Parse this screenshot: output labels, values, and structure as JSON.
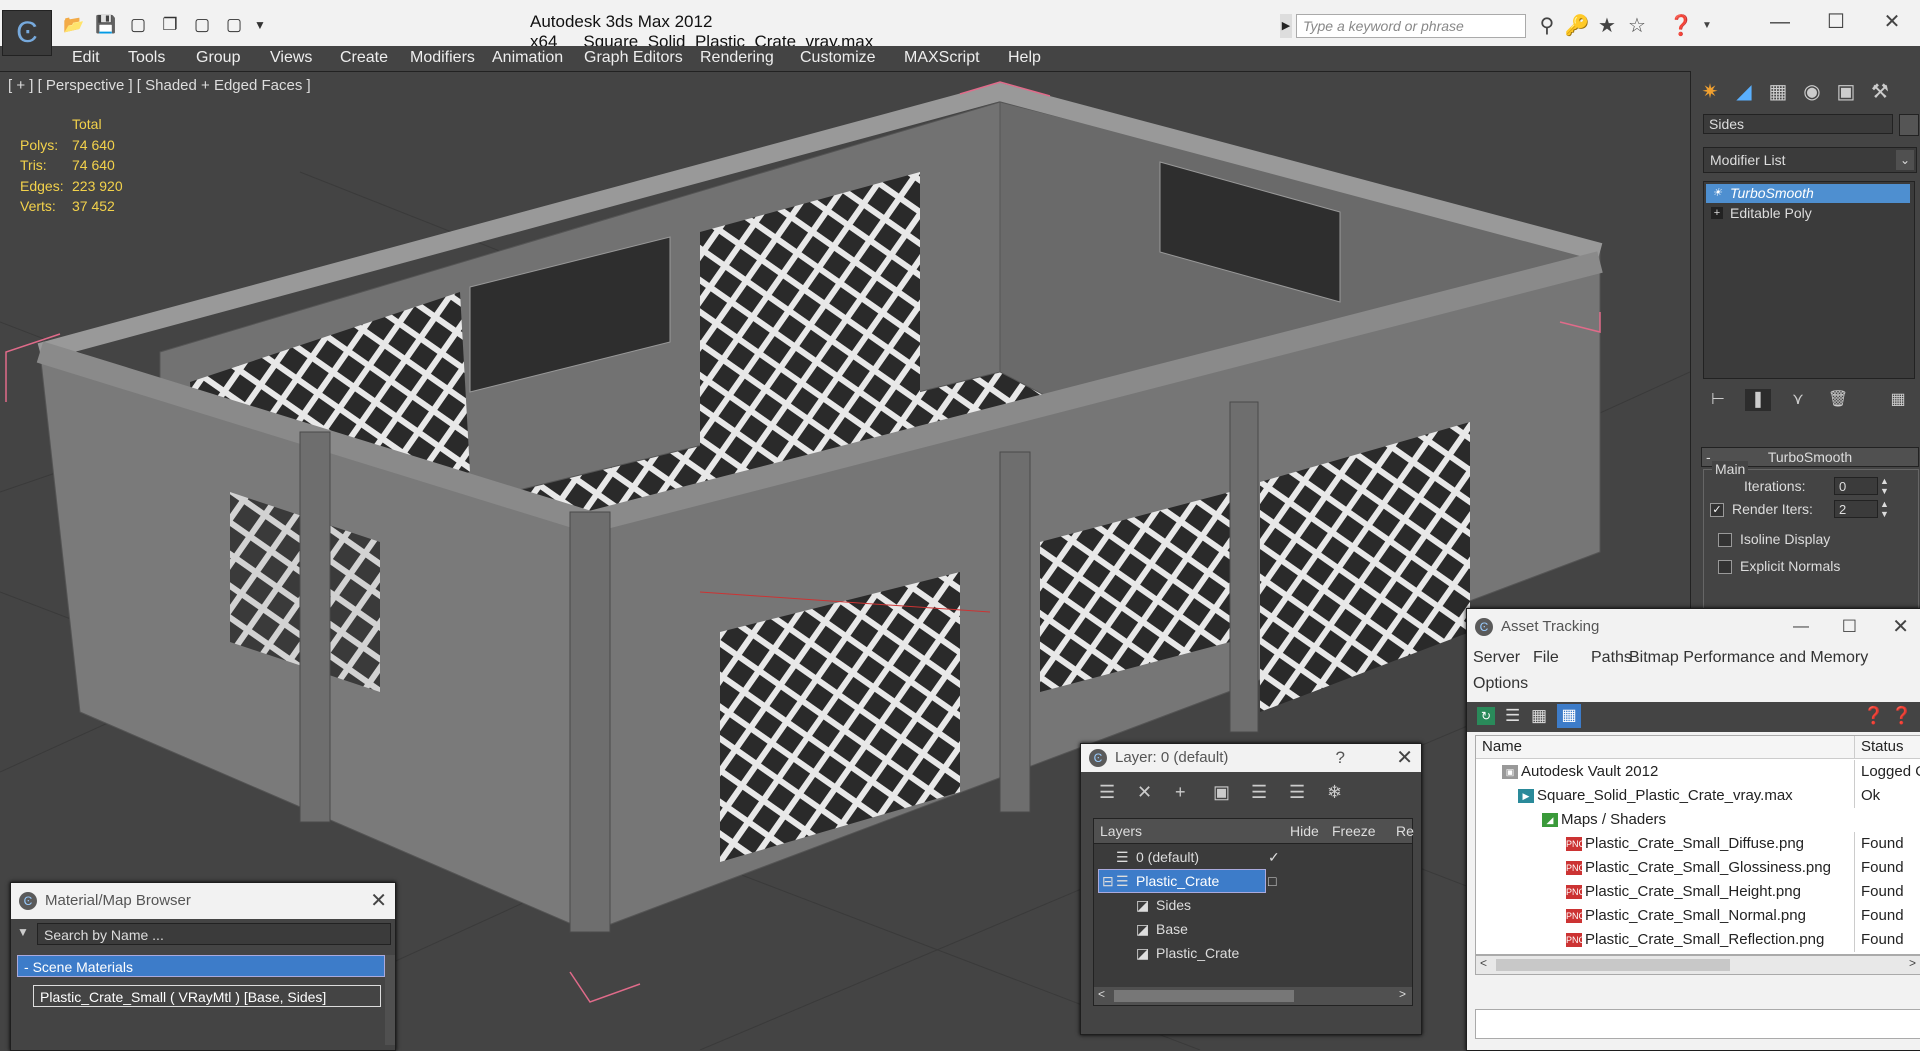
{
  "app": {
    "title": "Autodesk 3ds Max  2012 x64",
    "filename": "Square_Solid_Plastic_Crate_vray.max",
    "search_placeholder": "Type a keyword or phrase"
  },
  "menu": [
    "Edit",
    "Tools",
    "Group",
    "Views",
    "Create",
    "Modifiers",
    "Animation",
    "Graph Editors",
    "Rendering",
    "Customize",
    "MAXScript",
    "Help"
  ],
  "viewport": {
    "label": "[ + ] [ Perspective ] [ Shaded + Edged Faces ]",
    "stats_header": "Total",
    "stats": [
      {
        "label": "Polys:",
        "value": "74 640"
      },
      {
        "label": "Tris:",
        "value": "74 640"
      },
      {
        "label": "Edges:",
        "value": "223 920"
      },
      {
        "label": "Verts:",
        "value": "37 452"
      }
    ]
  },
  "command_panel": {
    "object_name": "Sides",
    "modifier_list": "Modifier List",
    "stack": [
      "TurboSmooth",
      "Editable Poly"
    ],
    "rollout_title": "TurboSmooth",
    "group_title": "Main",
    "iterations_label": "Iterations:",
    "iterations_value": "0",
    "render_iters_label": "Render Iters:",
    "render_iters_value": "2",
    "isoline_label": "Isoline Display",
    "explicit_normals_label": "Explicit Normals"
  },
  "asset_tracking": {
    "title": "Asset Tracking",
    "menu": [
      "Server",
      "File",
      "Paths",
      "Bitmap Performance and Memory",
      "Options"
    ],
    "col_name": "Name",
    "col_status": "Status",
    "rows": [
      {
        "name": "Autodesk Vault 2012",
        "status": "Logged O"
      },
      {
        "name": "Square_Solid_Plastic_Crate_vray.max",
        "status": "Ok"
      },
      {
        "name": "Maps / Shaders",
        "status": ""
      },
      {
        "name": "Plastic_Crate_Small_Diffuse.png",
        "status": "Found"
      },
      {
        "name": "Plastic_Crate_Small_Glossiness.png",
        "status": "Found"
      },
      {
        "name": "Plastic_Crate_Small_Height.png",
        "status": "Found"
      },
      {
        "name": "Plastic_Crate_Small_Normal.png",
        "status": "Found"
      },
      {
        "name": "Plastic_Crate_Small_Reflection.png",
        "status": "Found"
      }
    ]
  },
  "layer_window": {
    "title": "Layer: 0 (default)",
    "help": "?",
    "col_layers": "Layers",
    "col_hide": "Hide",
    "col_freeze": "Freeze",
    "col_render": "Re",
    "rows": [
      "0 (default)",
      "Plastic_Crate",
      "Sides",
      "Base",
      "Plastic_Crate"
    ]
  },
  "material_browser": {
    "title": "Material/Map Browser",
    "search_placeholder": "Search by Name ...",
    "group": "Scene Materials",
    "item": "Plastic_Crate_Small  ( VRayMtl )  [Base, Sides]"
  }
}
